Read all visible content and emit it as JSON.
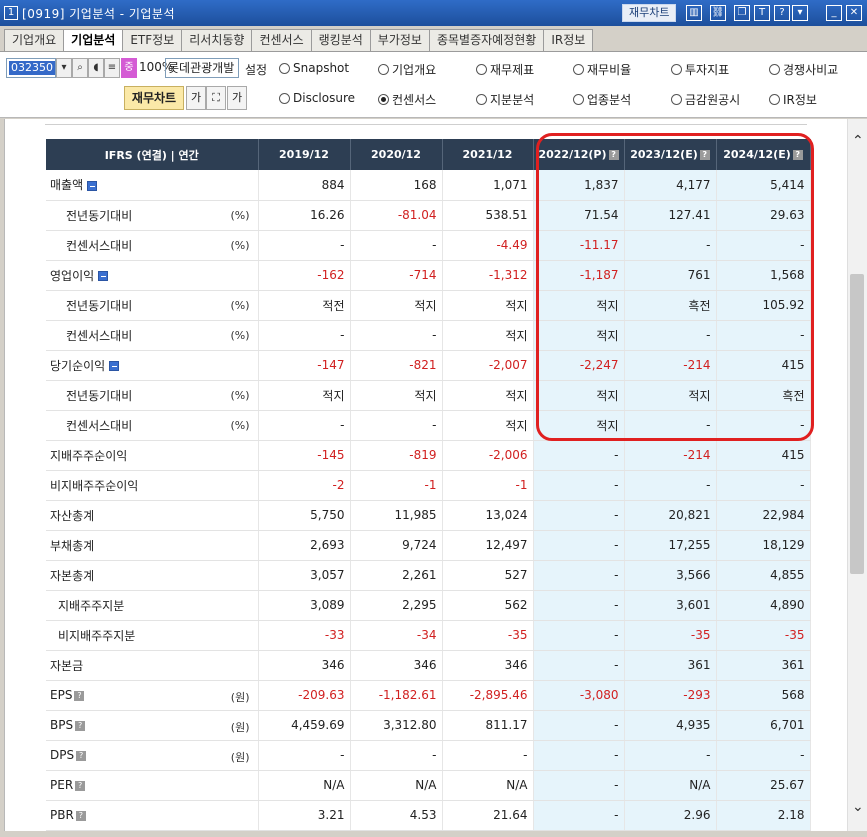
{
  "window": {
    "code": "0919",
    "title": "기업분석 - 기업분석",
    "fin_button": "재무차트"
  },
  "tabs": [
    "기업개요",
    "기업분석",
    "ETF정보",
    "리서치동향",
    "컨센서스",
    "랭킹분석",
    "부가정보",
    "종목별증자예정현황",
    "IR정보"
  ],
  "toolbar": {
    "stock_code": "032350",
    "zoom": "100%",
    "company": "롯데관광개발",
    "settings_label": "설정",
    "chip_label": "중",
    "fin_chart_label": "재무차트",
    "radios_row1": [
      "Snapshot",
      "기업개요",
      "재무제표",
      "재무비율",
      "투자지표",
      "경쟁사비교"
    ],
    "radios_row2": [
      "Disclosure",
      "컨센서스",
      "지분분석",
      "업종분석",
      "금감원공시",
      "IR정보"
    ],
    "selected": "컨센서스"
  },
  "table": {
    "header_label": "IFRS (연결) | 연간",
    "columns": [
      "2019/12",
      "2020/12",
      "2021/12",
      "2022/12(P)",
      "2023/12(E)",
      "2024/12(E)"
    ],
    "estimate_cols": [
      3,
      4,
      5
    ],
    "rows": [
      {
        "label": "매출액",
        "level": 0,
        "expand": true,
        "unit": "",
        "values": [
          "884",
          "168",
          "1,071",
          "1,837",
          "4,177",
          "5,414"
        ]
      },
      {
        "label": "전년동기대비",
        "level": 1,
        "unit": "(%)",
        "values": [
          "16.26",
          "-81.04",
          "538.51",
          "71.54",
          "127.41",
          "29.63"
        ]
      },
      {
        "label": "컨센서스대비",
        "level": 1,
        "unit": "(%)",
        "values": [
          "-",
          "-",
          "-4.49",
          "-11.17",
          "-",
          "-"
        ]
      },
      {
        "label": "영업이익",
        "level": 0,
        "expand": true,
        "unit": "",
        "values": [
          "-162",
          "-714",
          "-1,312",
          "-1,187",
          "761",
          "1,568"
        ]
      },
      {
        "label": "전년동기대비",
        "level": 1,
        "unit": "(%)",
        "values": [
          "적전",
          "적지",
          "적지",
          "적지",
          "흑전",
          "105.92"
        ]
      },
      {
        "label": "컨센서스대비",
        "level": 1,
        "unit": "(%)",
        "values": [
          "-",
          "-",
          "적지",
          "적지",
          "-",
          "-"
        ]
      },
      {
        "label": "당기순이익",
        "level": 0,
        "expand": true,
        "unit": "",
        "values": [
          "-147",
          "-821",
          "-2,007",
          "-2,247",
          "-214",
          "415"
        ]
      },
      {
        "label": "전년동기대비",
        "level": 1,
        "unit": "(%)",
        "values": [
          "적지",
          "적지",
          "적지",
          "적지",
          "적지",
          "흑전"
        ]
      },
      {
        "label": "컨센서스대비",
        "level": 1,
        "unit": "(%)",
        "values": [
          "-",
          "-",
          "적지",
          "적지",
          "-",
          "-"
        ]
      },
      {
        "label": "지배주주순이익",
        "level": 0,
        "unit": "",
        "values": [
          "-145",
          "-819",
          "-2,006",
          "-",
          "-214",
          "415"
        ]
      },
      {
        "label": "비지배주주순이익",
        "level": 0,
        "unit": "",
        "values": [
          "-2",
          "-1",
          "-1",
          "-",
          "-",
          "-"
        ]
      },
      {
        "label": "자산총계",
        "level": 0,
        "unit": "",
        "values": [
          "5,750",
          "11,985",
          "13,024",
          "-",
          "20,821",
          "22,984"
        ]
      },
      {
        "label": "부채총계",
        "level": 0,
        "unit": "",
        "values": [
          "2,693",
          "9,724",
          "12,497",
          "-",
          "17,255",
          "18,129"
        ]
      },
      {
        "label": "자본총계",
        "level": 0,
        "unit": "",
        "values": [
          "3,057",
          "2,261",
          "527",
          "-",
          "3,566",
          "4,855"
        ]
      },
      {
        "label": "지배주주지분",
        "level": 2,
        "unit": "",
        "values": [
          "3,089",
          "2,295",
          "562",
          "-",
          "3,601",
          "4,890"
        ]
      },
      {
        "label": "비지배주주지분",
        "level": 2,
        "unit": "",
        "values": [
          "-33",
          "-34",
          "-35",
          "-",
          "-35",
          "-35"
        ]
      },
      {
        "label": "자본금",
        "level": 0,
        "unit": "",
        "values": [
          "346",
          "346",
          "346",
          "-",
          "361",
          "361"
        ]
      },
      {
        "label": "EPS",
        "level": 0,
        "info": true,
        "unit": "(원)",
        "values": [
          "-209.63",
          "-1,182.61",
          "-2,895.46",
          "-3,080",
          "-293",
          "568"
        ]
      },
      {
        "label": "BPS",
        "level": 0,
        "info": true,
        "unit": "(원)",
        "values": [
          "4,459.69",
          "3,312.80",
          "811.17",
          "-",
          "4,935",
          "6,701"
        ]
      },
      {
        "label": "DPS",
        "level": 0,
        "info": true,
        "unit": "(원)",
        "values": [
          "-",
          "-",
          "-",
          "-",
          "-",
          "-"
        ]
      },
      {
        "label": "PER",
        "level": 0,
        "info": true,
        "unit": "",
        "values": [
          "N/A",
          "N/A",
          "N/A",
          "-",
          "N/A",
          "25.67"
        ]
      },
      {
        "label": "PBR",
        "level": 0,
        "info": true,
        "unit": "",
        "values": [
          "3.21",
          "4.53",
          "21.64",
          "-",
          "2.96",
          "2.18"
        ]
      }
    ]
  },
  "colors": {
    "header_bg": "#2d3e53",
    "estimate_bg": "#e6f4fb",
    "negative": "#d12020",
    "highlight": "#e02020"
  }
}
